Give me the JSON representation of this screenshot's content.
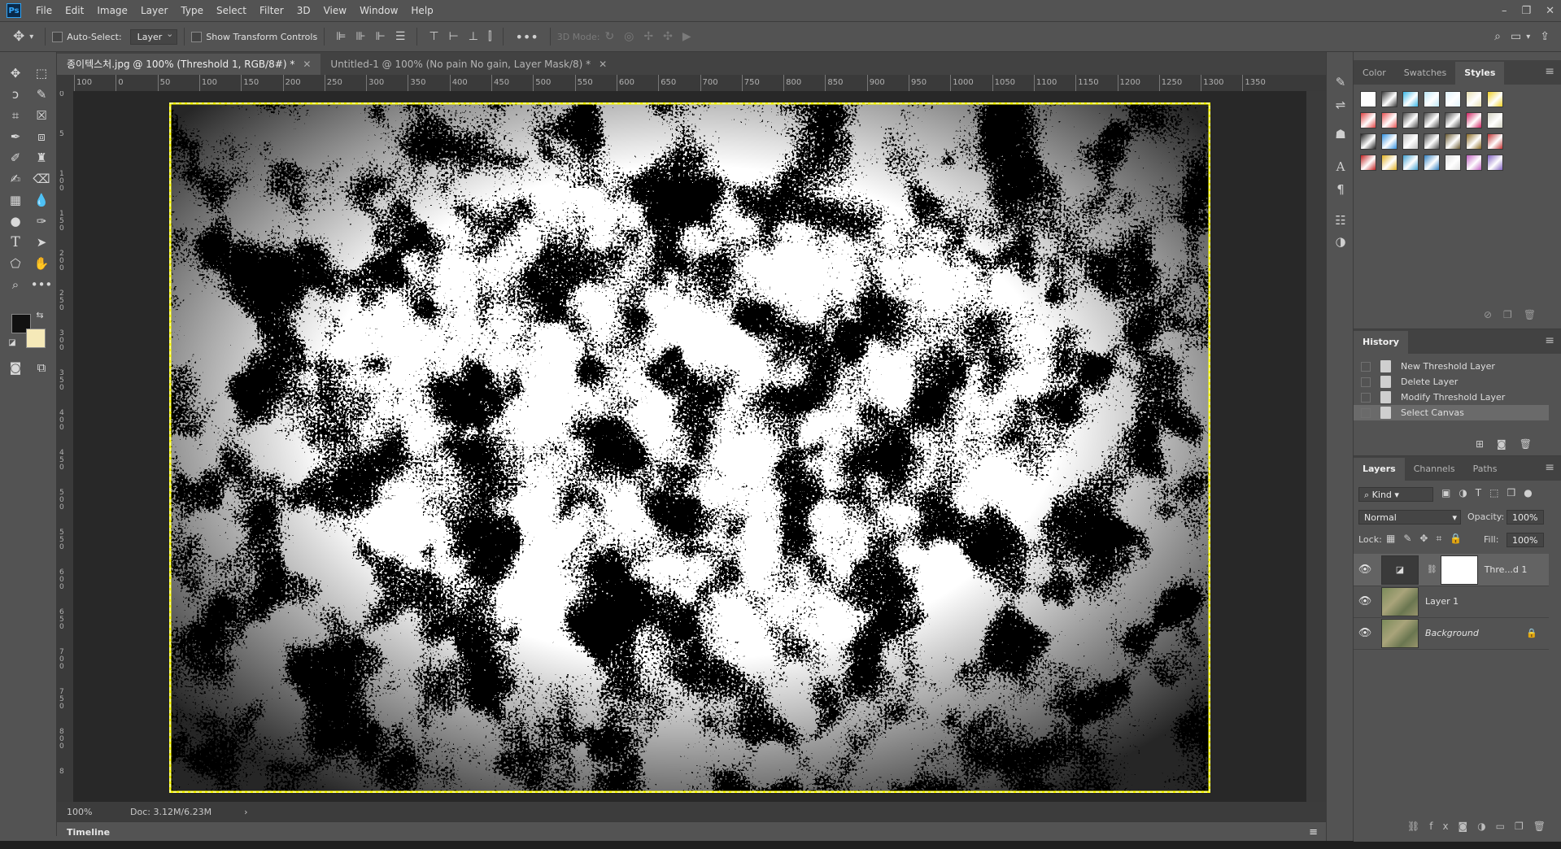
{
  "app": {
    "logo_text": "Ps"
  },
  "menu": [
    "File",
    "Edit",
    "Image",
    "Layer",
    "Type",
    "Select",
    "Filter",
    "3D",
    "View",
    "Window",
    "Help"
  ],
  "window_controls": [
    "–",
    "❐",
    "✕"
  ],
  "options_bar": {
    "auto_select_label": "Auto-Select:",
    "auto_select_value": "Layer",
    "show_transform_label": "Show Transform Controls",
    "mode_label": "3D Mode:"
  },
  "tabs": [
    {
      "label": "종이텍스처.jpg @ 100% (Threshold 1, RGB/8#) *",
      "active": true
    },
    {
      "label": "Untitled-1 @ 100% (No pain No gain, Layer Mask/8) *",
      "active": false
    }
  ],
  "ruler": {
    "h_ticks": [
      "100",
      "0",
      "50",
      "100",
      "150",
      "200",
      "250",
      "300",
      "350",
      "400",
      "450",
      "500",
      "550",
      "600",
      "650",
      "700",
      "750",
      "800",
      "850",
      "900",
      "950",
      "1000",
      "1050",
      "1100",
      "1150",
      "1200",
      "1250",
      "1300",
      "1350"
    ],
    "v_ticks": [
      "0",
      "5",
      "1 0 0",
      "1 5 0",
      "2 0 0",
      "2 5 0",
      "3 0 0",
      "3 5 0",
      "4 0 0",
      "4 5 0",
      "5 0 0",
      "5 5 0",
      "6 0 0",
      "6 5 0",
      "7 0 0",
      "7 5 0",
      "8 0 0",
      "8"
    ]
  },
  "status": {
    "zoom": "100%",
    "doc": "Doc: 3.12M/6.23M",
    "arrow": "›"
  },
  "timeline": {
    "label": "Timeline",
    "menu": "≡"
  },
  "color_panel": {
    "tabs": [
      "Color",
      "Swatches",
      "Styles"
    ],
    "active_tab": "Styles",
    "swatch_colors": [
      [
        "#ffffff",
        "#3a3a3a",
        "#38b8e8",
        "#bde8f8",
        "#dff2fb",
        "#e8e0b0",
        "#f0d020"
      ],
      [
        "#e04040",
        "#e85050",
        "#4a4a4a",
        "#4a4a4a",
        "#4a4a4a",
        "#d02060",
        "#d0d0c0"
      ],
      [
        "#202020",
        "#3090e0",
        "#c0c0c0",
        "#505050",
        "#6a5a30",
        "#8a6a20",
        "#c03030"
      ],
      [
        "#c02020",
        "#e0b020",
        "#40a0d0",
        "#3080c0",
        "#e0e0e0",
        "#c060c0",
        "#8060c0"
      ]
    ]
  },
  "history": {
    "title": "History",
    "items": [
      {
        "label": "New Threshold Layer",
        "selected": false
      },
      {
        "label": "Delete Layer",
        "selected": false
      },
      {
        "label": "Modify Threshold Layer",
        "selected": false
      },
      {
        "label": "Select Canvas",
        "selected": true
      }
    ]
  },
  "layers": {
    "tabs": [
      "Layers",
      "Channels",
      "Paths"
    ],
    "active_tab": "Layers",
    "filter_kind": "Kind",
    "blend_mode": "Normal",
    "opacity_label": "Opacity:",
    "opacity": "100%",
    "lock_label": "Lock:",
    "fill_label": "Fill:",
    "fill": "100%",
    "items": [
      {
        "name": "Thre...d 1",
        "selected": true,
        "locked": false
      },
      {
        "name": "Layer 1",
        "selected": false,
        "locked": false
      },
      {
        "name": "Background",
        "selected": false,
        "locked": true
      }
    ]
  },
  "colors": {
    "foreground": "#111111",
    "background": "#f5e9b8",
    "selection_highlight": "#ffff00"
  }
}
